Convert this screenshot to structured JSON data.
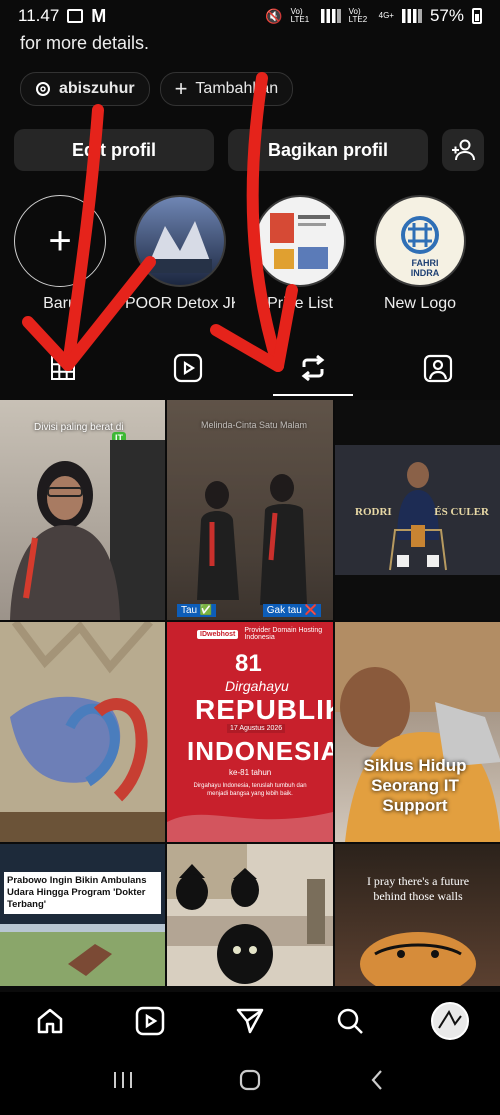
{
  "status": {
    "time": "11.47",
    "battery": "57%",
    "sim1": "Vo) LTE1",
    "sim2": "Vo) LTE2",
    "net": "4G+"
  },
  "profile": {
    "bio_tail": "for more details.",
    "threads_chip": "abiszuhur",
    "add_chip": "Tambahkan",
    "edit_button": "Edit profil",
    "share_button": "Bagikan profil"
  },
  "highlights": [
    {
      "label": "Baru"
    },
    {
      "label": "POOR Detox JK..."
    },
    {
      "label": "Price List"
    },
    {
      "label": "New Logo"
    }
  ],
  "tabs": [
    {
      "name": "grid",
      "icon": "grid-icon"
    },
    {
      "name": "reels",
      "icon": "reels-icon"
    },
    {
      "name": "reposts",
      "icon": "repost-icon",
      "active": true
    },
    {
      "name": "tagged",
      "icon": "tagged-icon"
    }
  ],
  "posts": [
    {
      "caption": "Divisi paling berat di",
      "badge": "IT"
    },
    {
      "caption": "Melinda-Cinta Satu Malam",
      "left_tag": "Tau ✅",
      "right_tag": "Gak tau ❌"
    },
    {
      "left": "RODRI",
      "right": "ÉS CULER"
    },
    {
      "caption": ""
    },
    {
      "header": "Provider Domain Hosting Indonesia",
      "number": "81",
      "line1": "Dirgahayu",
      "line2": "REPUBLIK",
      "date": "17 Agustus 2026",
      "line3": "INDONESIA",
      "sub": "ke-81 tahun",
      "body": "Dirgahayu Indonesia, teruslah tumbuh dan menjadi bangsa yang lebih baik."
    },
    {
      "caption": "Siklus Hidup Seorang IT Support"
    },
    {
      "caption": "Prabowo Ingin Bikin Ambulans Udara Hingga Program 'Dokter Terbang'"
    },
    {
      "caption": ""
    },
    {
      "caption": "I pray there's a future behind those walls"
    }
  ],
  "logo": {
    "line1": "FAHRI",
    "line2": "INDRA"
  },
  "colors": {
    "background": "#0b0b0b",
    "button": "#262626",
    "arrow": "#e5231b",
    "active": "#ffffff"
  }
}
